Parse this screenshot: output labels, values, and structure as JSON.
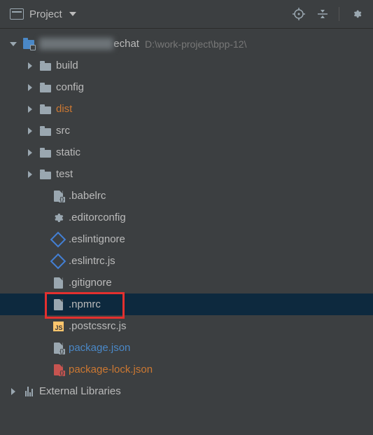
{
  "header": {
    "title": "Project"
  },
  "root": {
    "name_hidden": "██████████",
    "name_suffix": "echat",
    "path": "D:\\work-project\\bpp-12\\"
  },
  "folders": [
    {
      "label": "build",
      "color": "normal"
    },
    {
      "label": "config",
      "color": "normal"
    },
    {
      "label": "dist",
      "color": "orange"
    },
    {
      "label": "src",
      "color": "normal"
    },
    {
      "label": "static",
      "color": "normal"
    },
    {
      "label": "test",
      "color": "normal"
    }
  ],
  "files": [
    {
      "label": ".babelrc",
      "icon": "file-cfg",
      "color": "normal"
    },
    {
      "label": ".editorconfig",
      "icon": "gear",
      "color": "normal"
    },
    {
      "label": ".eslintignore",
      "icon": "hex",
      "color": "normal"
    },
    {
      "label": ".eslintrc.js",
      "icon": "hex",
      "color": "normal"
    },
    {
      "label": ".gitignore",
      "icon": "file",
      "color": "normal"
    },
    {
      "label": ".npmrc",
      "icon": "file",
      "color": "normal",
      "selected": true,
      "highlight": true
    },
    {
      "label": ".postcssrc.js",
      "icon": "js",
      "color": "normal"
    },
    {
      "label": "package.json",
      "icon": "file-cfg",
      "color": "blue"
    },
    {
      "label": "package-lock.json",
      "icon": "file-cfg-o",
      "color": "orange"
    }
  ],
  "external": {
    "label": "External Libraries"
  }
}
